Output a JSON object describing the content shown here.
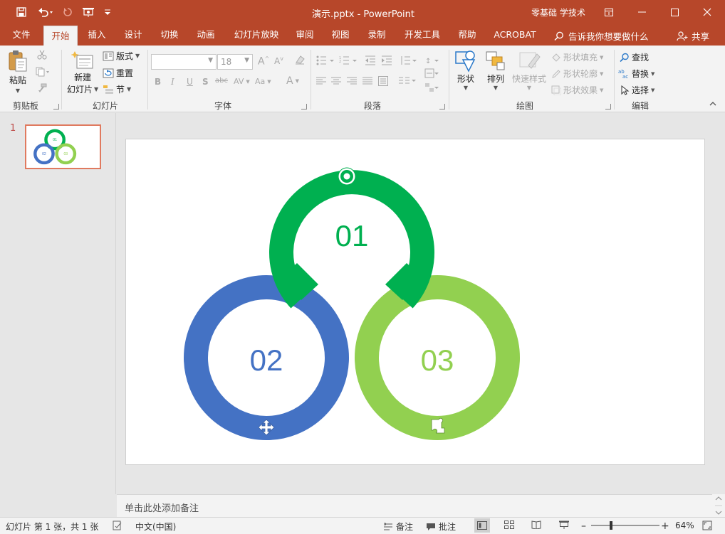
{
  "titlebar": {
    "doc_title": "演示.pptx  -  PowerPoint",
    "user_name": "零基础 学技术"
  },
  "tabs": [
    {
      "label": "文件"
    },
    {
      "label": "开始"
    },
    {
      "label": "插入"
    },
    {
      "label": "设计"
    },
    {
      "label": "切换"
    },
    {
      "label": "动画"
    },
    {
      "label": "幻灯片放映"
    },
    {
      "label": "审阅"
    },
    {
      "label": "视图"
    },
    {
      "label": "录制"
    },
    {
      "label": "开发工具"
    },
    {
      "label": "帮助"
    },
    {
      "label": "ACROBAT"
    }
  ],
  "tellme": "告诉我你想要做什么",
  "share": "共享",
  "ribbon": {
    "clipboard": {
      "paste": "粘贴",
      "group": "剪贴板"
    },
    "slides": {
      "new_line1": "新建",
      "new_line2": "幻灯片",
      "layout": "版式",
      "reset": "重置",
      "section": "节",
      "group": "幻灯片"
    },
    "font": {
      "font_name": "",
      "font_size": "18",
      "group": "字体"
    },
    "paragraph": {
      "group": "段落"
    },
    "drawing": {
      "shapes": "形状",
      "arrange": "排列",
      "quick_styles": "快速样式",
      "fill": "形状填充",
      "outline": "形状轮廓",
      "effects": "形状效果",
      "group": "绘图"
    },
    "editing": {
      "find": "查找",
      "replace": "替换",
      "select": "选择",
      "group": "编辑"
    }
  },
  "thumbs": {
    "number": "1"
  },
  "slide": {
    "labels": [
      "01",
      "02",
      "03"
    ],
    "colors": {
      "green": "#00b050",
      "blue": "#4472c4",
      "lightgreen": "#92d050"
    }
  },
  "notes_placeholder": "单击此处添加备注",
  "statusbar": {
    "slide_info": "幻灯片 第 1 张，共 1 张",
    "language": "中文(中国)",
    "notes": "备注",
    "comments": "批注",
    "zoom": "64%"
  }
}
